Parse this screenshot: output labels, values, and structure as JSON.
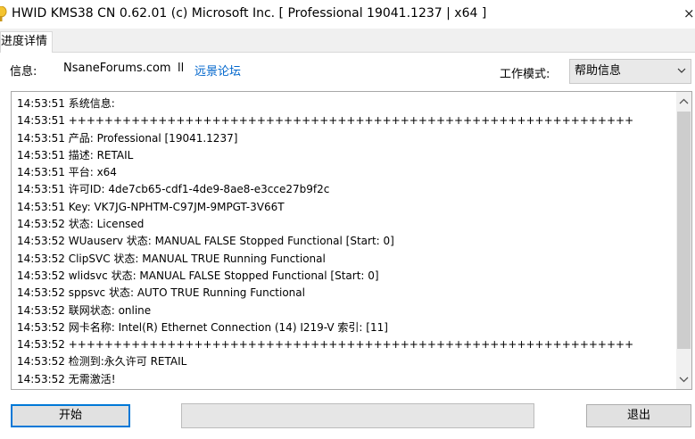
{
  "window": {
    "title": "HWID KMS38 CN 0.62.01 (c) Microsoft Inc. [ Professional 19041.1237 | x64 ]",
    "close_glyph": "×"
  },
  "tabs": [
    {
      "label": "进度详情",
      "selected": true
    }
  ],
  "info": {
    "label": "信息:",
    "site": "NsaneForums.com",
    "separator": "ll",
    "link": "远景论坛"
  },
  "mode": {
    "label": "工作模式:",
    "selected": "帮助信息"
  },
  "log_lines": [
    "14:53:51 系统信息:",
    "14:53:51 +++++++++++++++++++++++++++++++++++++++++++++++++++++++++++++++",
    "14:53:51 产品: Professional [19041.1237]",
    "14:53:51 描述: RETAIL",
    "14:53:51 平台: x64",
    "14:53:51 许可ID: 4de7cb65-cdf1-4de9-8ae8-e3cce27b9f2c",
    "14:53:51 Key: VK7JG-NPHTM-C97JM-9MPGT-3V66T",
    "14:53:52 状态: Licensed",
    "14:53:52 WUauserv 状态: MANUAL FALSE Stopped Functional [Start: 0]",
    "14:53:52 ClipSVC 状态: MANUAL TRUE Running Functional",
    "14:53:52 wlidsvc 状态: MANUAL FALSE Stopped Functional [Start: 0]",
    "14:53:52 sppsvc 状态: AUTO TRUE Running Functional",
    "14:53:52 联网状态: online",
    "14:53:52 网卡名称: Intel(R) Ethernet Connection (14) I219-V 索引: [11]",
    "14:53:52 +++++++++++++++++++++++++++++++++++++++++++++++++++++++++++++++",
    "14:53:52 检测到:永久许可 RETAIL",
    "14:53:52 无需激活!"
  ],
  "buttons": {
    "start": "开始",
    "exit": "退出"
  },
  "progress": {
    "fraction": 0
  },
  "colors": {
    "accent": "#0078d7",
    "link": "#0066cc"
  }
}
